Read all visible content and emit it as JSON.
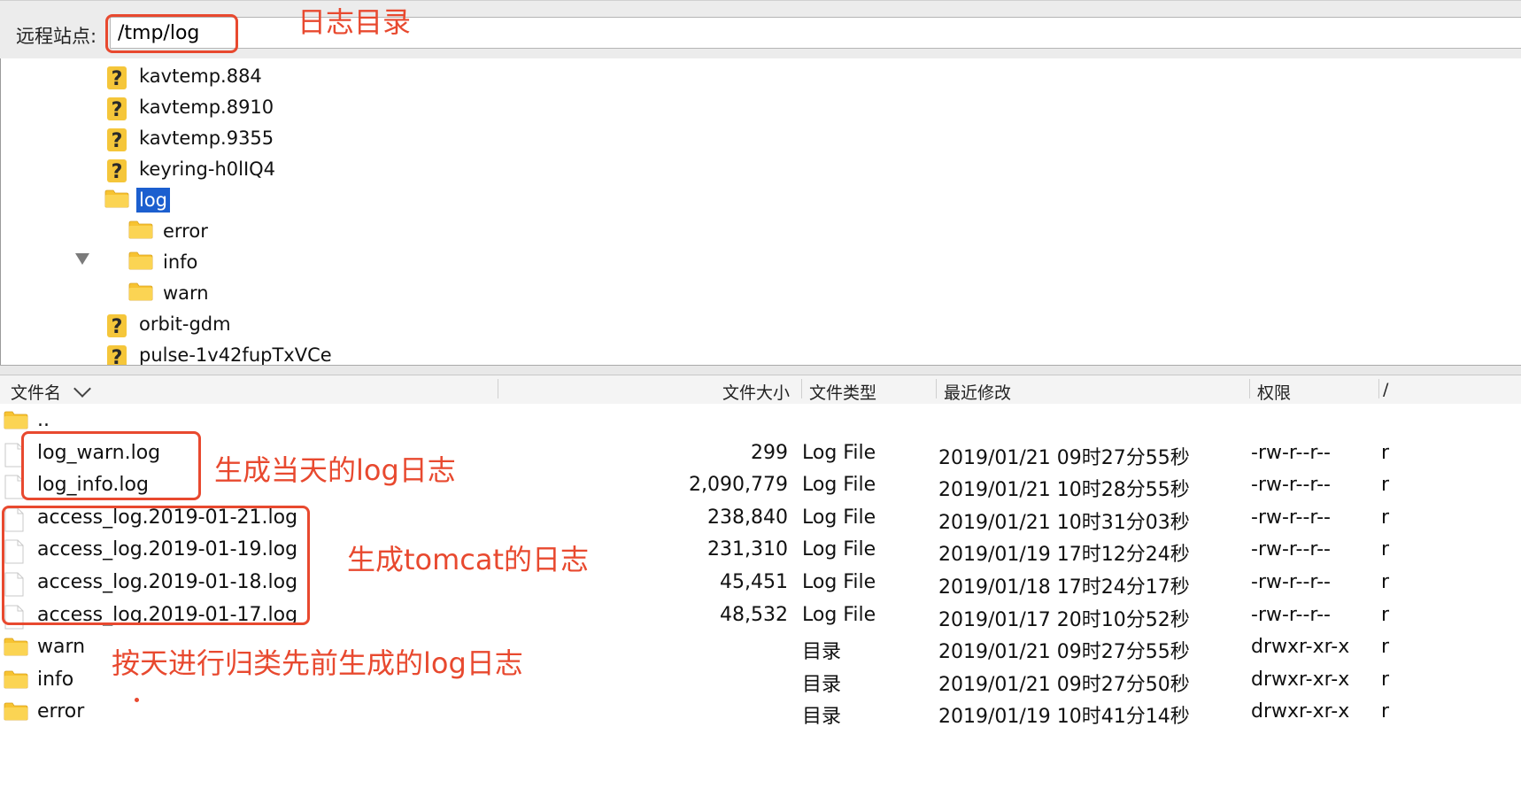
{
  "pathbar": {
    "label": "远程站点:",
    "path": "/tmp/log"
  },
  "tree": {
    "items": [
      {
        "name": "kavtemp.884",
        "icon": "unknown-icon"
      },
      {
        "name": "kavtemp.8910",
        "icon": "unknown-icon"
      },
      {
        "name": "kavtemp.9355",
        "icon": "unknown-icon"
      },
      {
        "name": "keyring-h0lIQ4",
        "icon": "unknown-icon"
      },
      {
        "name": "log",
        "icon": "folder-icon",
        "selected": true,
        "expanded": true
      },
      {
        "name": "error",
        "icon": "folder-icon"
      },
      {
        "name": "info",
        "icon": "folder-icon"
      },
      {
        "name": "warn",
        "icon": "folder-icon"
      },
      {
        "name": "orbit-gdm",
        "icon": "unknown-icon"
      },
      {
        "name": "pulse-1v42fupTxVCe",
        "icon": "unknown-icon"
      }
    ]
  },
  "list": {
    "columns": {
      "name": "文件名",
      "size": "文件大小",
      "type": "文件类型",
      "modified": "最近修改",
      "perms": "权限",
      "owner": "/"
    },
    "rows": [
      {
        "icon": "folder-icon",
        "name": "..",
        "size": "",
        "type": "",
        "modified": "",
        "perms": "",
        "owner": ""
      },
      {
        "icon": "file-icon",
        "name": "log_warn.log",
        "size": "299",
        "type": "Log File",
        "modified": "2019/01/21 09时27分55秒",
        "perms": "-rw-r--r--",
        "owner": "r"
      },
      {
        "icon": "file-icon",
        "name": "log_info.log",
        "size": "2,090,779",
        "type": "Log File",
        "modified": "2019/01/21 10时28分55秒",
        "perms": "-rw-r--r--",
        "owner": "r"
      },
      {
        "icon": "file-icon",
        "name": "access_log.2019-01-21.log",
        "size": "238,840",
        "type": "Log File",
        "modified": "2019/01/21 10时31分03秒",
        "perms": "-rw-r--r--",
        "owner": "r"
      },
      {
        "icon": "file-icon",
        "name": "access_log.2019-01-19.log",
        "size": "231,310",
        "type": "Log File",
        "modified": "2019/01/19 17时12分24秒",
        "perms": "-rw-r--r--",
        "owner": "r"
      },
      {
        "icon": "file-icon",
        "name": "access_log.2019-01-18.log",
        "size": "45,451",
        "type": "Log File",
        "modified": "2019/01/18 17时24分17秒",
        "perms": "-rw-r--r--",
        "owner": "r"
      },
      {
        "icon": "file-icon",
        "name": "access_log.2019-01-17.log",
        "size": "48,532",
        "type": "Log File",
        "modified": "2019/01/17 20时10分52秒",
        "perms": "-rw-r--r--",
        "owner": "r"
      },
      {
        "icon": "folder-icon",
        "name": "warn",
        "size": "",
        "type": "目录",
        "modified": "2019/01/21 09时27分55秒",
        "perms": "drwxr-xr-x",
        "owner": "r"
      },
      {
        "icon": "folder-icon",
        "name": "info",
        "size": "",
        "type": "目录",
        "modified": "2019/01/21 09时27分50秒",
        "perms": "drwxr-xr-x",
        "owner": "r"
      },
      {
        "icon": "folder-icon",
        "name": "error",
        "size": "",
        "type": "目录",
        "modified": "2019/01/19 10时41分14秒",
        "perms": "drwxr-xr-x",
        "owner": "r"
      }
    ]
  },
  "annotations": {
    "log_dir": "日志目录",
    "daily_log": "生成当天的log日志",
    "tomcat_log": "生成tomcat的日志",
    "archived_log": "按天进行归类先前生成的log日志"
  },
  "colors": {
    "annotation": "#e8492f",
    "selection": "#1c5fcf",
    "folder": "#f7c331"
  }
}
